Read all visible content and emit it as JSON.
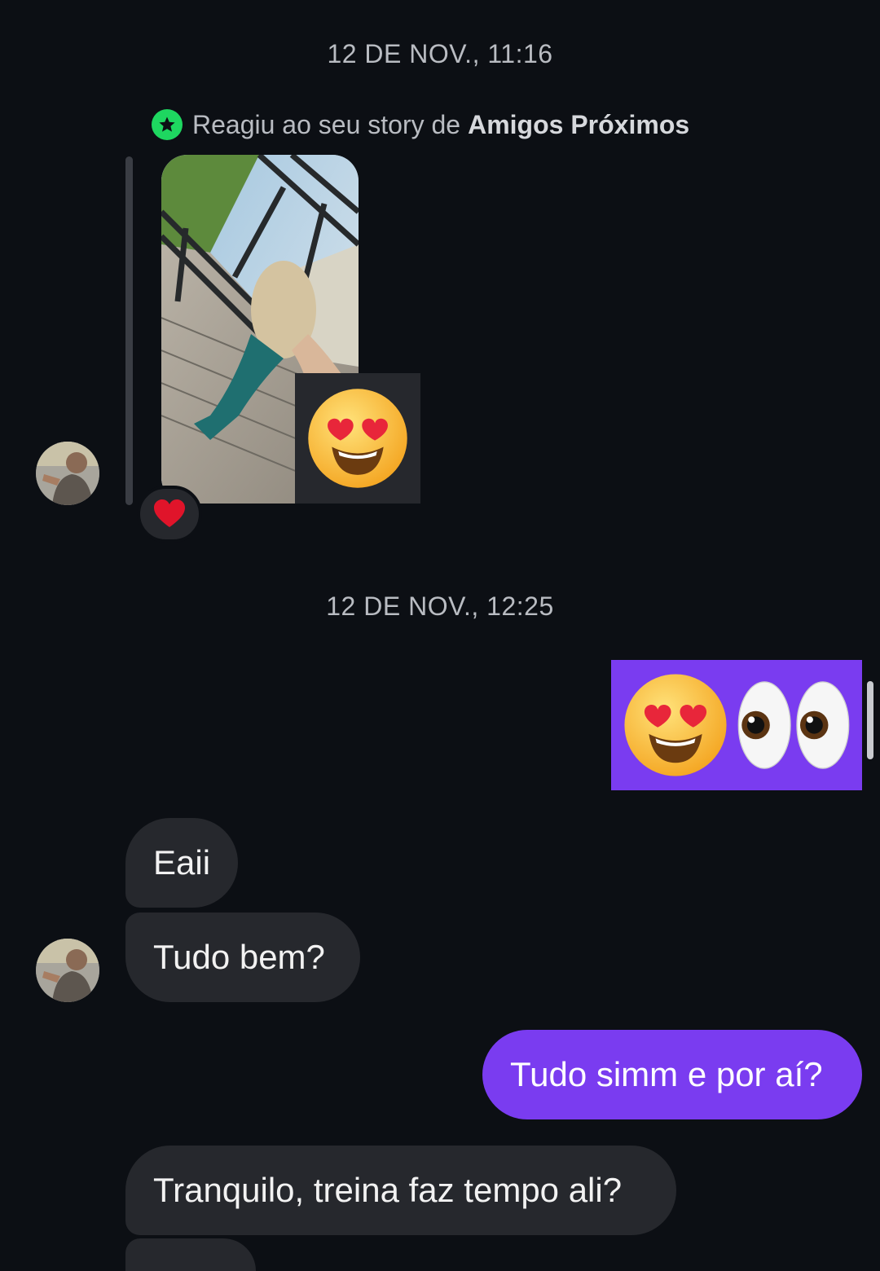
{
  "timestamps": [
    "12 DE NOV., 11:16",
    "12 DE NOV., 12:25"
  ],
  "story_reply": {
    "prefix": "Reagiu ao seu story de",
    "story_type": "Amigos Próximos",
    "badge_icon": "star-icon",
    "reaction_emoji": "heart-eyes-emoji",
    "story_reaction": "red-heart-emoji"
  },
  "sent_emoji_message": [
    "heart-eyes-emoji",
    "eyes-emoji"
  ],
  "messages": [
    {
      "from": "them",
      "text": "Eaii"
    },
    {
      "from": "them",
      "text": "Tudo bem?"
    },
    {
      "from": "me",
      "text": "Tudo simm e por aí?"
    },
    {
      "from": "them",
      "text": "Tranquilo, treina faz tempo ali?"
    }
  ],
  "colors": {
    "background": "#0c0f14",
    "sent_bubble": "#7a3cf0",
    "received_bubble": "#26282d",
    "close_friends_green": "#1ed760"
  }
}
